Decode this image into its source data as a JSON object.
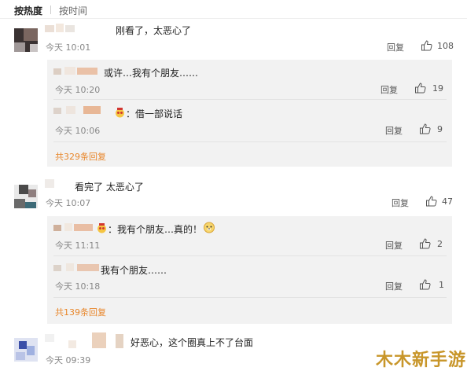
{
  "sort": {
    "hot": "按热度",
    "time": "按时间"
  },
  "comments": [
    {
      "text": "刚看了，太恶心了",
      "time": "今天 10:01",
      "reply": "回复",
      "likes": "108",
      "subs": [
        {
          "text": "或许…我有个朋友……",
          "time": "今天 10:20",
          "reply": "回复",
          "likes": "19"
        },
        {
          "text": "：借一部说话",
          "time": "今天 10:06",
          "reply": "回复",
          "likes": "9"
        }
      ],
      "more": "共329条回复"
    },
    {
      "text": "看完了 太恶心了",
      "time": "今天 10:07",
      "reply": "回复",
      "likes": "47",
      "subs": [
        {
          "text": "：我有个朋友…真的！",
          "time": "今天 11:11",
          "reply": "回复",
          "likes": "2"
        },
        {
          "text": "我有个朋友……",
          "time": "今天 10:18",
          "reply": "回复",
          "likes": "1"
        }
      ],
      "more": "共139条回复"
    },
    {
      "text": "好恶心，这个圈真上不了台面",
      "time": "今天 09:39"
    }
  ],
  "watermark": "木木新手游",
  "colors": {
    "more_link": "#e8862a",
    "sub_bg": "#f2f2f2"
  }
}
